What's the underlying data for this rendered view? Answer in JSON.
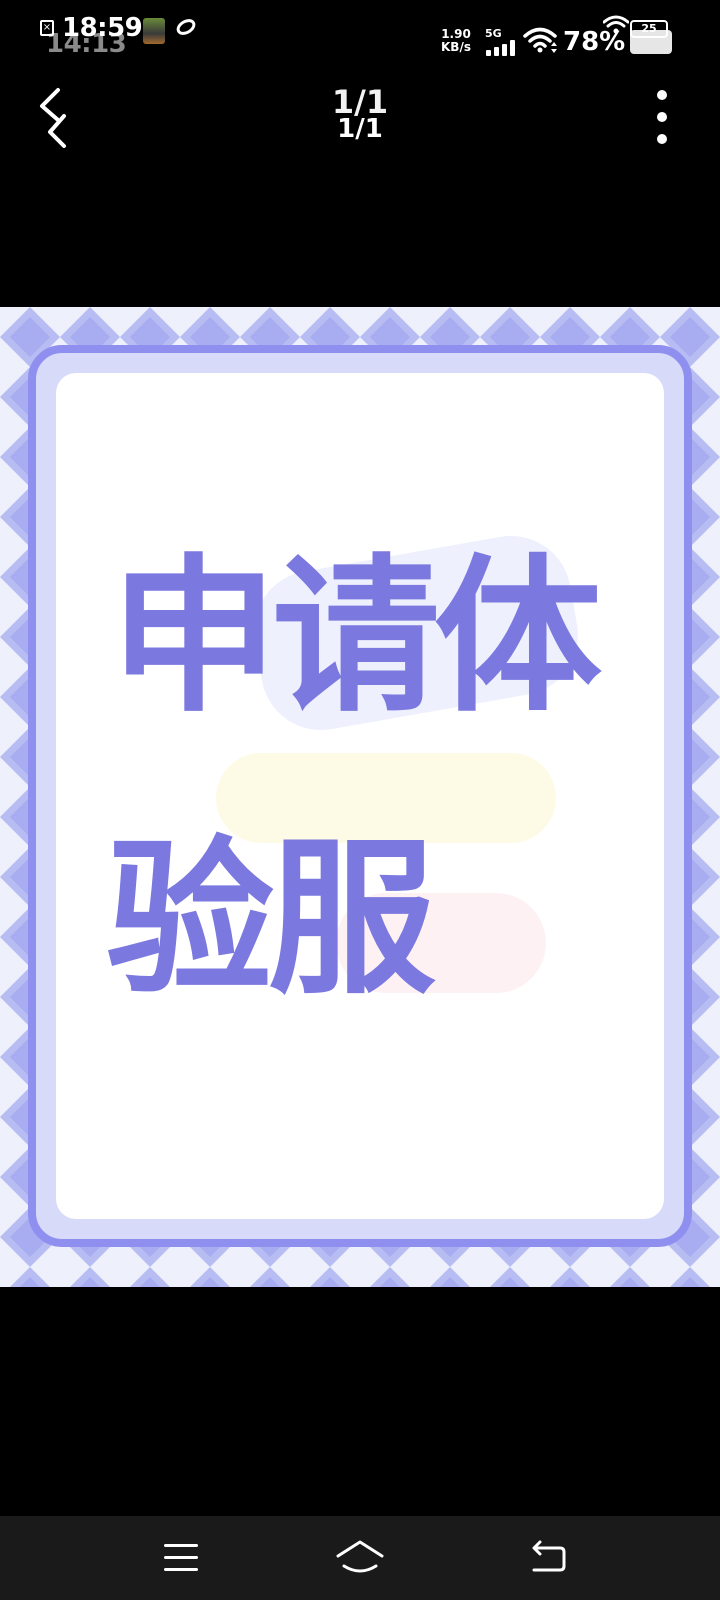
{
  "status_bar": {
    "time": "18:59",
    "time_secondary": "14:13",
    "network_speed_value": "1.90",
    "network_speed_unit": "KB/s",
    "network_type": "5G",
    "battery_percent": "78%",
    "battery_level_badge": "25"
  },
  "toolbar": {
    "page_indicator": "1/1",
    "page_indicator_secondary": "1/1"
  },
  "poster": {
    "line1": "申请体",
    "line2": "验服"
  },
  "colors": {
    "accent_purple": "#7b78e0",
    "frame_purple": "#8f8ff0",
    "background": "#000000"
  },
  "icons": {
    "back": "chevron-left-icon",
    "more": "more-vertical-icon",
    "menu": "menu-icon",
    "home": "home-icon",
    "return": "return-icon"
  }
}
